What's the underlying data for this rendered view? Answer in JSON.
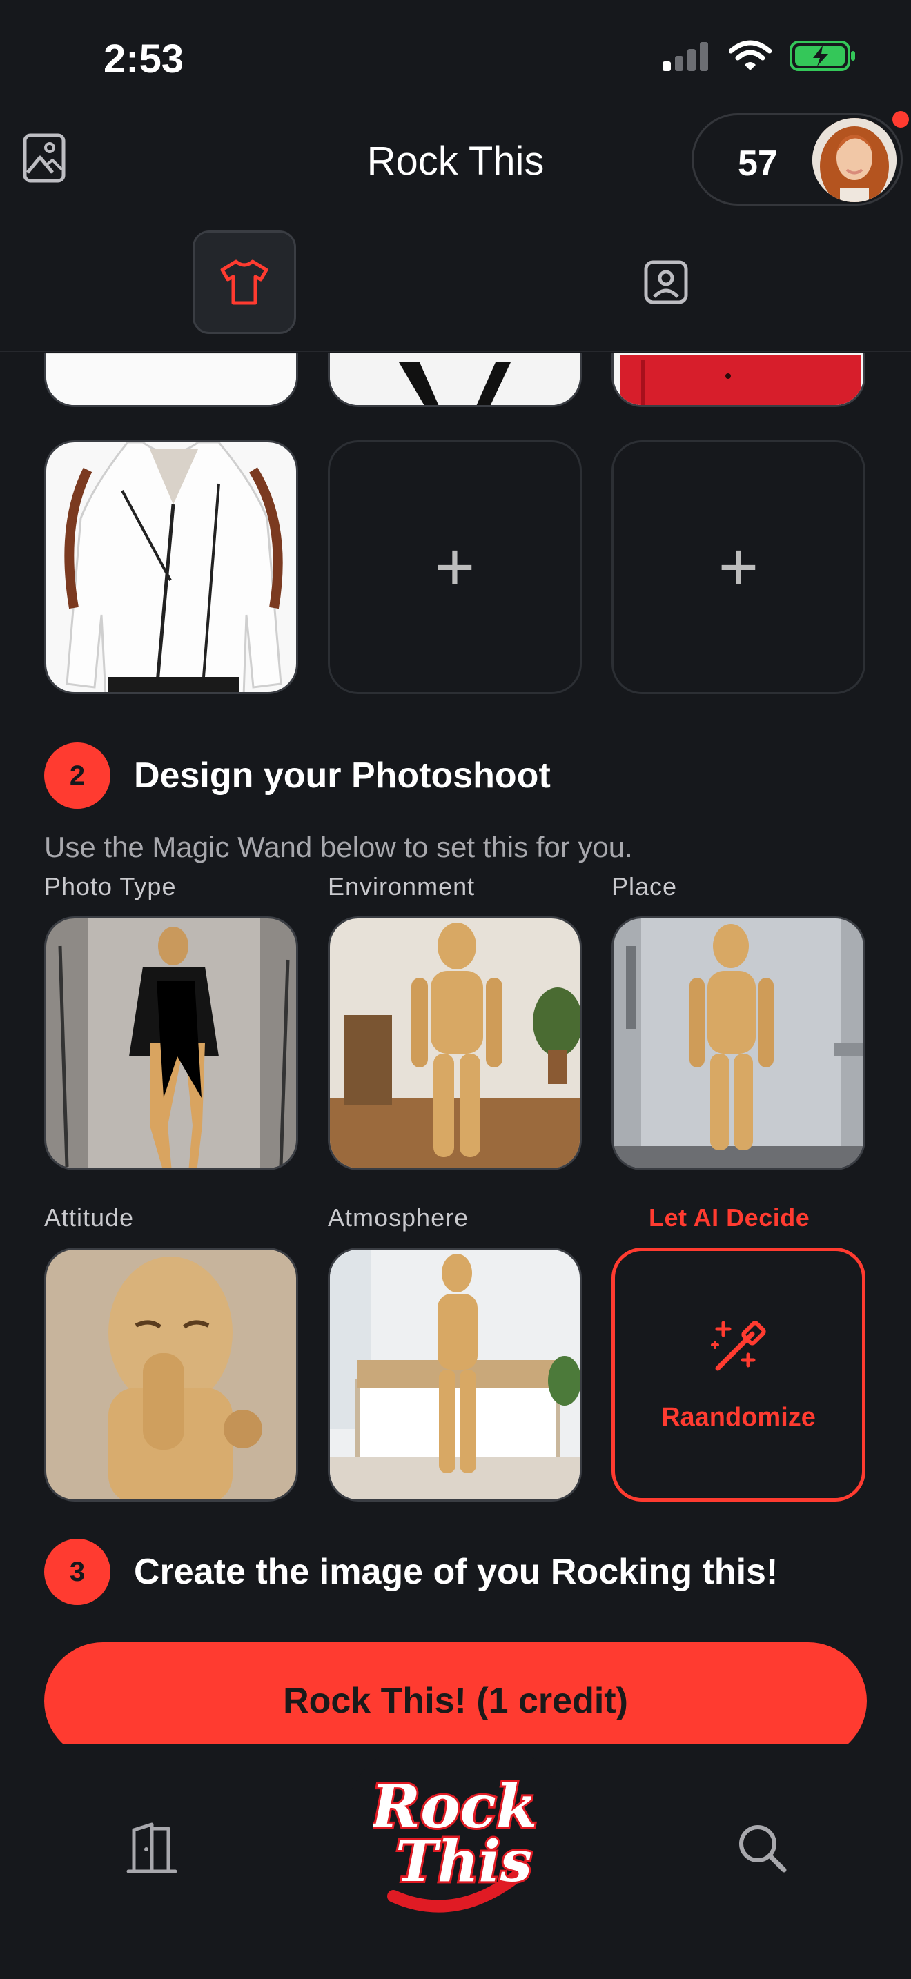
{
  "status": {
    "time": "2:53"
  },
  "header": {
    "title": "Rock This",
    "credits": "57"
  },
  "step2": {
    "number": "2",
    "title": "Design your Photoshoot",
    "hint": "Use the Magic Wand below to set this for you.",
    "options": [
      {
        "label": "Photo Type"
      },
      {
        "label": "Environment"
      },
      {
        "label": "Place"
      },
      {
        "label": "Attitude"
      },
      {
        "label": "Atmosphere"
      }
    ],
    "ai": {
      "label": "Let AI Decide",
      "button": "Raandomize"
    }
  },
  "step3": {
    "number": "3",
    "title": "Create the image of you Rocking this!",
    "cta": "Rock This! (1 credit)"
  },
  "logo": {
    "line1": "Rock",
    "line2": "This"
  },
  "colors": {
    "accent": "#ff3b30",
    "background": "#16181c"
  }
}
